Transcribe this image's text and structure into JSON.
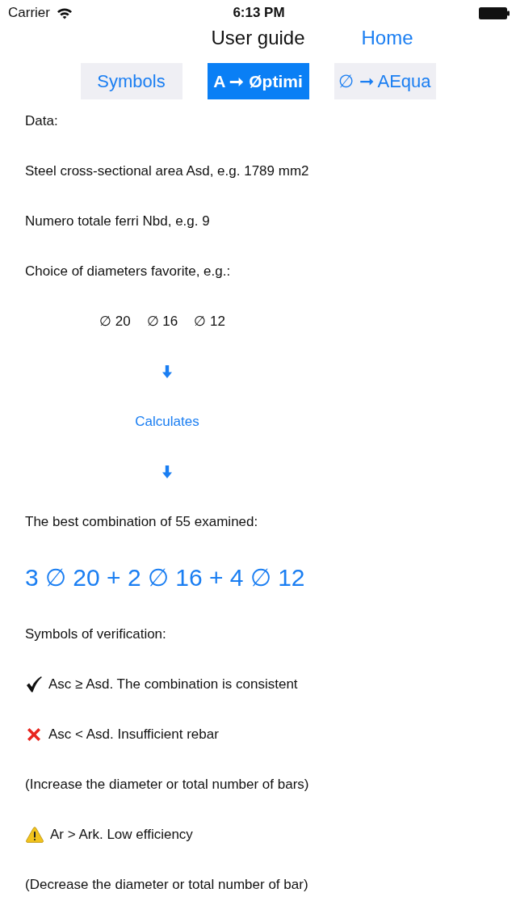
{
  "status_bar": {
    "carrier": "Carrier",
    "time": "6:13 PM"
  },
  "nav_bar": {
    "title": "User guide",
    "home": "Home"
  },
  "tabs": [
    {
      "label": "Symbols",
      "selected": false
    },
    {
      "label": "A ➞ Øptimi",
      "selected": true
    },
    {
      "label": "∅ ➞ AEqua",
      "selected": false
    }
  ],
  "content": [
    {
      "kind": "text",
      "text": "Data:"
    },
    {
      "kind": "text",
      "text": "Steel cross-sectional area Asd, e.g. 1789 mm2"
    },
    {
      "kind": "text",
      "text": "Numero totale ferri Nbd, e.g. 9"
    },
    {
      "kind": "text",
      "text": "Choice of diameters favorite, e.g.:"
    },
    {
      "kind": "diameters",
      "items": [
        "∅ 20",
        "∅ 16",
        "∅ 12"
      ]
    },
    {
      "kind": "arrow"
    },
    {
      "kind": "action",
      "text": "Calculates"
    },
    {
      "kind": "arrow"
    },
    {
      "kind": "text",
      "text": "The best combination of 55 examined:"
    },
    {
      "kind": "result",
      "text": "3 ∅ 20 + 2 ∅ 16 + 4 ∅ 12"
    },
    {
      "kind": "text",
      "text": "Symbols of verification:"
    },
    {
      "kind": "ok",
      "text": "Asc ≥ Asd. The combination is consistent"
    },
    {
      "kind": "error",
      "text": "Asc < Asd. Insufficient rebar"
    },
    {
      "kind": "text",
      "text": "(Increase the diameter or total number of bars)"
    },
    {
      "kind": "warning",
      "text": "Ar > Ark. Low efficiency"
    },
    {
      "kind": "text",
      "text": "(Decrease the diameter or total number of bar)"
    }
  ]
}
